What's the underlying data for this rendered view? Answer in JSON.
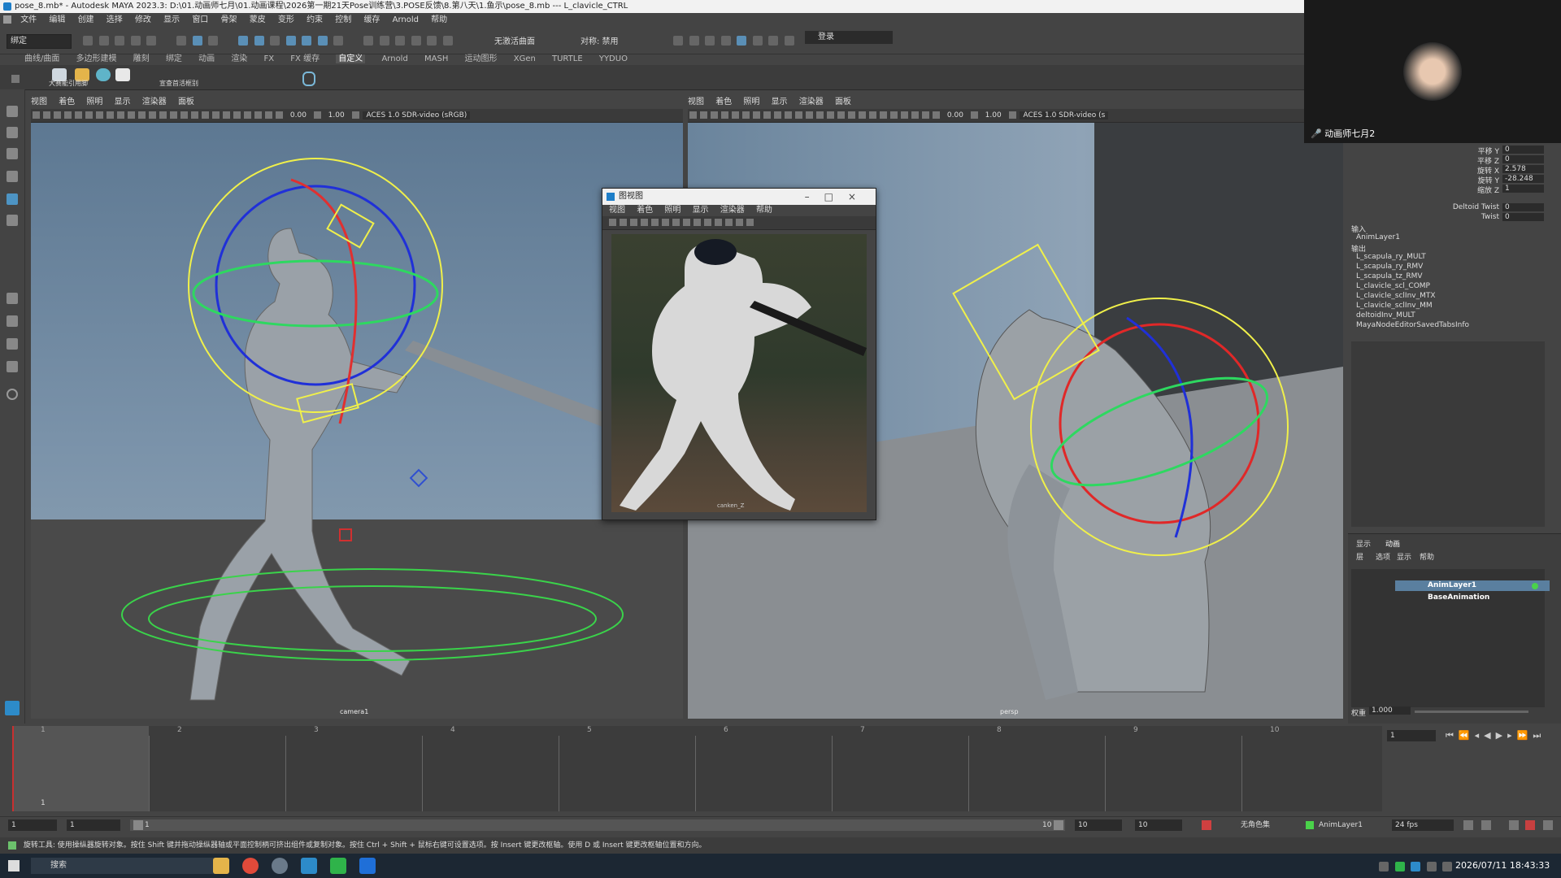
{
  "window": {
    "title": "pose_8.mb* - Autodesk MAYA 2023.3: D:\\01.动画师七月\\01.动画课程\\2026第一期21天Pose训练营\\3.POSE反馈\\8.第八天\\1.鱼示\\pose_8.mb   ---   L_clavicle_CTRL"
  },
  "menubar": [
    "文件",
    "编辑",
    "创建",
    "选择",
    "修改",
    "显示",
    "窗口",
    "骨架",
    "蒙皮",
    "变形",
    "约束",
    "控制",
    "缓存",
    "Arnold",
    "帮助"
  ],
  "status_line": {
    "workspace": "绑定",
    "text_1": "无激活曲面",
    "text_2": "对称: 禁用",
    "login": "登录"
  },
  "shelf": {
    "tabs": [
      "曲线/曲面",
      "多边形建模",
      "雕刻",
      "绑定",
      "动画",
      "渲染",
      "FX",
      "FX 缓存",
      "自定义",
      "Arnold",
      "MASH",
      "运动图形",
      "XGen",
      "TURTLE",
      "YYDUO"
    ],
    "active_tab": "自定义",
    "labels": [
      "大赛能引用脚",
      "宣查首活框别"
    ]
  },
  "viewport_left": {
    "menu": [
      "视图",
      "着色",
      "照明",
      "显示",
      "渲染器",
      "面板"
    ],
    "value_a": "0.00",
    "value_b": "1.00",
    "colorspace": "ACES 1.0 SDR-video (sRGB)",
    "camera": "camera1"
  },
  "viewport_right": {
    "menu": [
      "视图",
      "着色",
      "照明",
      "显示",
      "渲染器",
      "面板"
    ],
    "value_a": "0.00",
    "value_b": "1.00",
    "colorspace": "ACES 1.0 SDR-video (s",
    "camera": "persp"
  },
  "float_window": {
    "title": "图视图",
    "menu": [
      "视图",
      "着色",
      "照明",
      "显示",
      "渲染器",
      "帮助"
    ],
    "image_caption": "canken_Z"
  },
  "webcam": {
    "label": "动画师七月2"
  },
  "channel_box": {
    "channels": [
      {
        "name": "平移 Y",
        "value": "0"
      },
      {
        "name": "平移 Z",
        "value": "0"
      },
      {
        "name": "旋转 X",
        "value": "2.578"
      },
      {
        "name": "旋转 Y",
        "value": "-28.248"
      },
      {
        "name": "缩放 Z",
        "value": "1"
      },
      {
        "name": "Deltoid Twist",
        "value": "0"
      },
      {
        "name": "Twist",
        "value": "0"
      }
    ],
    "inputs_header": "输入",
    "inputs": [
      "AnimLayer1"
    ],
    "outputs_header": "输出",
    "outputs": [
      "L_scapula_ry_MULT",
      "L_scapula_ry_RMV",
      "L_scapula_tz_RMV",
      "L_clavicle_scl_COMP",
      "L_clavicle_sclInv_MTX",
      "L_clavicle_sclInv_MM",
      "deltoidInv_MULT",
      "MayaNodeEditorSavedTabsInfo"
    ]
  },
  "layer_editor": {
    "tabs": [
      "显示",
      "动画"
    ],
    "menu": [
      "层",
      "选项",
      "显示",
      "帮助"
    ],
    "layers": [
      "AnimLayer1",
      "BaseAnimation"
    ],
    "weight_label": "权重",
    "weight_value": "1.000"
  },
  "timeline": {
    "ticks": [
      "1",
      "2",
      "3",
      "4",
      "5",
      "6",
      "7",
      "8",
      "9",
      "10"
    ],
    "current_frame_label": "1",
    "current_frame_field": "1"
  },
  "range_slider": {
    "start": "1",
    "inner_start": "1",
    "slider_start": "1",
    "slider_end": "10",
    "end": "10",
    "outer_end": "10",
    "character_set": "无角色集",
    "anim_layer": "AnimLayer1",
    "fps": "24 fps"
  },
  "help_line": "旋转工具: 使用操纵器旋转对象。按住 Shift 键并拖动操纵器轴或平面控制柄可挤出组件或复制对象。按住 Ctrl + Shift + 鼠标右键可设置选项。按 Insert 键更改枢轴。使用 D 或 Insert 键更改枢轴位置和方向。",
  "taskbar": {
    "search": "搜索",
    "clock": "2026/07/11 18:43:33"
  }
}
